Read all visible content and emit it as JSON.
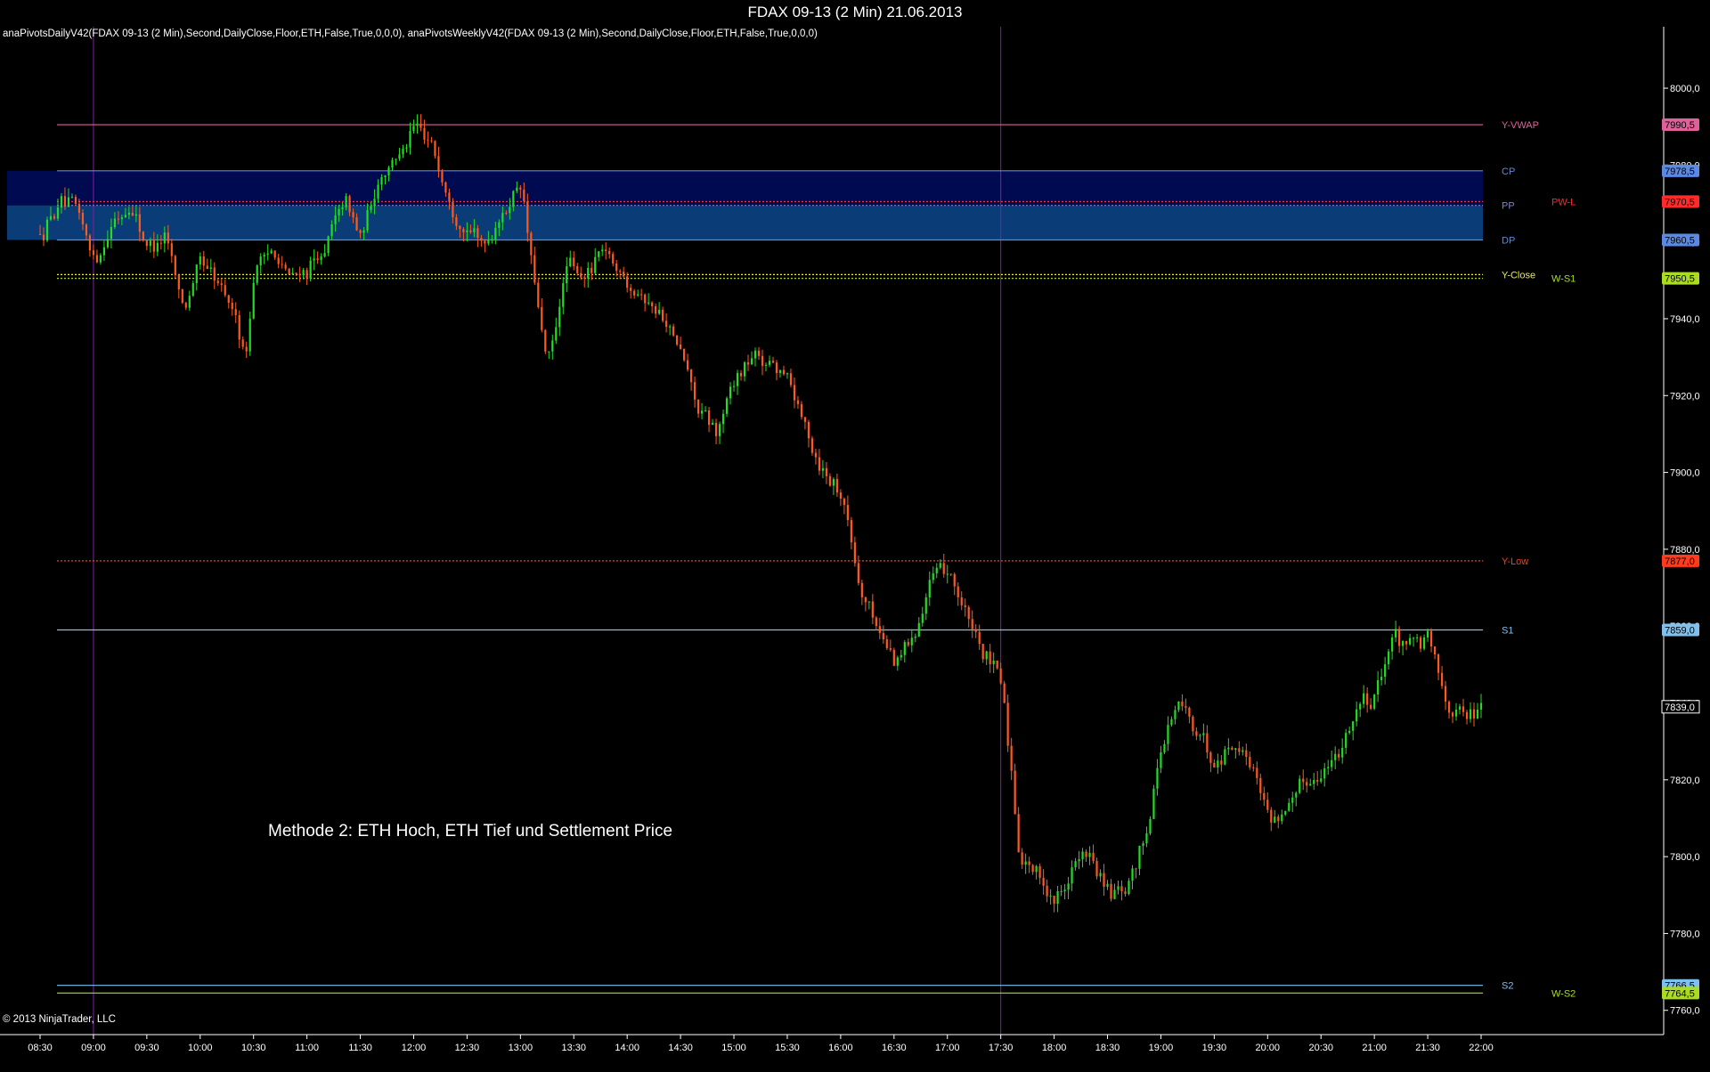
{
  "window": {
    "title": "FDAX 09-13 (2 Min)  21.06.2013"
  },
  "indicators": {
    "text": "anaPivotsDailyV42(FDAX 09-13 (2 Min),Second,DailyClose,Floor,ETH,False,True,0,0,0), anaPivotsWeeklyV42(FDAX 09-13 (2 Min),Second,DailyClose,Floor,ETH,False,True,0,0,0)"
  },
  "copyright": "© 2013 NinjaTrader, LLC",
  "annotation": "Methode 2: ETH Hoch, ETH Tief und Settlement Price",
  "colors": {
    "background": "#000000",
    "up_candle": "#22dd22",
    "down_candle": "#ff5a1e",
    "cpr_band_dark": "#000a50",
    "cpr_band_light": "#0a3c78",
    "session_line": "#8020a0"
  },
  "chart_data": {
    "type": "candlestick",
    "title": "FDAX 09-13 (2 Min)  21.06.2013",
    "x_axis": {
      "ticks": [
        "08:30",
        "09:00",
        "09:30",
        "10:00",
        "10:30",
        "11:00",
        "11:30",
        "12:00",
        "12:30",
        "13:00",
        "13:30",
        "14:00",
        "14:30",
        "15:00",
        "15:30",
        "16:00",
        "16:30",
        "17:00",
        "17:30",
        "18:00",
        "18:30",
        "19:00",
        "19:30",
        "20:00",
        "20:30",
        "21:00",
        "21:30",
        "22:00"
      ],
      "range": [
        "08:30",
        "22:00"
      ]
    },
    "y_axis": {
      "ticks": [
        7760,
        7780,
        7800,
        7820,
        7840,
        7860,
        7880,
        7900,
        7920,
        7940,
        7960,
        7980,
        8000
      ],
      "tick_labels": [
        "7760,0",
        "7780,0",
        "7800,0",
        "7820,0",
        "7840,0",
        "7860,0",
        "7880,0",
        "7900,0",
        "7920,0",
        "7940,0",
        "7960,0",
        "7980,0",
        "8000,0"
      ],
      "range": [
        7756,
        8016
      ],
      "side": "right"
    },
    "session_lines": [
      "09:00",
      "17:30"
    ],
    "levels": [
      {
        "label": "Y-VWAP",
        "value": 7990.5,
        "price_label": "7990,5",
        "color": "#e0609a",
        "style": "solid",
        "side": "daily"
      },
      {
        "label": "CP",
        "value": 7978.5,
        "price_label": "7978,5",
        "color": "#5a8ae6",
        "style": "solid",
        "side": "daily"
      },
      {
        "label": "PP",
        "value": 7969.5,
        "price_label": "",
        "color": "#8080d0",
        "style": "dotted",
        "side": "daily"
      },
      {
        "label": "PW-L",
        "value": 7970.5,
        "price_label": "7970,5",
        "color": "#ff2a2a",
        "style": "dotted",
        "side": "weekly"
      },
      {
        "label": "DP",
        "value": 7960.5,
        "price_label": "7960,5",
        "color": "#5a8ae6",
        "style": "solid",
        "side": "daily"
      },
      {
        "label": "Y-Close",
        "value": 7951.5,
        "price_label": "",
        "color": "#f0f020",
        "style": "dotted",
        "side": "daily"
      },
      {
        "label": "W-S1",
        "value": 7950.5,
        "price_label": "7950,5",
        "color": "#aadd22",
        "style": "dotted",
        "side": "weekly"
      },
      {
        "label": "Y-Low",
        "value": 7877.0,
        "price_label": "7877,0",
        "color": "#ff3b1e",
        "style": "dotted",
        "side": "daily"
      },
      {
        "label": "S1",
        "value": 7859.0,
        "price_label": "7859,0",
        "color": "#7ec0ee",
        "style": "solid",
        "side": "daily"
      },
      {
        "label": "S2",
        "value": 7766.5,
        "price_label": "7766,5",
        "color": "#7ec0ee",
        "style": "solid",
        "side": "daily"
      },
      {
        "label": "W-S2",
        "value": 7764.5,
        "price_label": "7764,5",
        "color": "#aadd22",
        "style": "solid",
        "side": "weekly"
      }
    ],
    "last_price": {
      "value": 7839.0,
      "label": "7839,0"
    },
    "cpr_band": {
      "top": 7978.5,
      "pp": 7969.5,
      "bottom": 7960.5
    },
    "price_path": [
      [
        "08:30",
        7962
      ],
      [
        "08:40",
        7970
      ],
      [
        "08:50",
        7968
      ],
      [
        "09:00",
        7955
      ],
      [
        "09:10",
        7965
      ],
      [
        "09:20",
        7970
      ],
      [
        "09:30",
        7958
      ],
      [
        "09:40",
        7962
      ],
      [
        "09:50",
        7942
      ],
      [
        "10:00",
        7955
      ],
      [
        "10:10",
        7948
      ],
      [
        "10:20",
        7940
      ],
      [
        "10:25",
        7928
      ],
      [
        "10:30",
        7955
      ],
      [
        "10:40",
        7958
      ],
      [
        "10:50",
        7950
      ],
      [
        "11:00",
        7953
      ],
      [
        "11:10",
        7958
      ],
      [
        "11:20",
        7972
      ],
      [
        "11:30",
        7960
      ],
      [
        "11:40",
        7978
      ],
      [
        "11:50",
        7982
      ],
      [
        "12:00",
        7990
      ],
      [
        "12:10",
        7985
      ],
      [
        "12:20",
        7970
      ],
      [
        "12:30",
        7962
      ],
      [
        "12:40",
        7960
      ],
      [
        "12:50",
        7968
      ],
      [
        "13:00",
        7975
      ],
      [
        "13:05",
        7955
      ],
      [
        "13:15",
        7925
      ],
      [
        "13:25",
        7955
      ],
      [
        "13:35",
        7950
      ],
      [
        "13:45",
        7958
      ],
      [
        "14:00",
        7950
      ],
      [
        "14:10",
        7945
      ],
      [
        "14:20",
        7940
      ],
      [
        "14:30",
        7930
      ],
      [
        "14:40",
        7915
      ],
      [
        "14:50",
        7910
      ],
      [
        "15:00",
        7925
      ],
      [
        "15:10",
        7930
      ],
      [
        "15:20",
        7928
      ],
      [
        "15:30",
        7925
      ],
      [
        "15:40",
        7910
      ],
      [
        "15:50",
        7900
      ],
      [
        "16:00",
        7895
      ],
      [
        "16:10",
        7870
      ],
      [
        "16:20",
        7860
      ],
      [
        "16:30",
        7850
      ],
      [
        "16:40",
        7858
      ],
      [
        "16:50",
        7872
      ],
      [
        "17:00",
        7875
      ],
      [
        "17:10",
        7862
      ],
      [
        "17:20",
        7852
      ],
      [
        "17:30",
        7845
      ],
      [
        "17:40",
        7800
      ],
      [
        "17:50",
        7795
      ],
      [
        "18:00",
        7788
      ],
      [
        "18:10",
        7798
      ],
      [
        "18:20",
        7800
      ],
      [
        "18:30",
        7790
      ],
      [
        "18:40",
        7790
      ],
      [
        "18:50",
        7805
      ],
      [
        "19:00",
        7830
      ],
      [
        "19:10",
        7840
      ],
      [
        "19:20",
        7832
      ],
      [
        "19:30",
        7825
      ],
      [
        "19:40",
        7830
      ],
      [
        "19:50",
        7825
      ],
      [
        "20:00",
        7810
      ],
      [
        "20:10",
        7812
      ],
      [
        "20:20",
        7820
      ],
      [
        "20:30",
        7822
      ],
      [
        "20:40",
        7828
      ],
      [
        "20:50",
        7840
      ],
      [
        "21:00",
        7842
      ],
      [
        "21:10",
        7858
      ],
      [
        "21:20",
        7855
      ],
      [
        "21:30",
        7856
      ],
      [
        "21:40",
        7840
      ],
      [
        "21:50",
        7836
      ],
      [
        "22:00",
        7839
      ]
    ]
  }
}
